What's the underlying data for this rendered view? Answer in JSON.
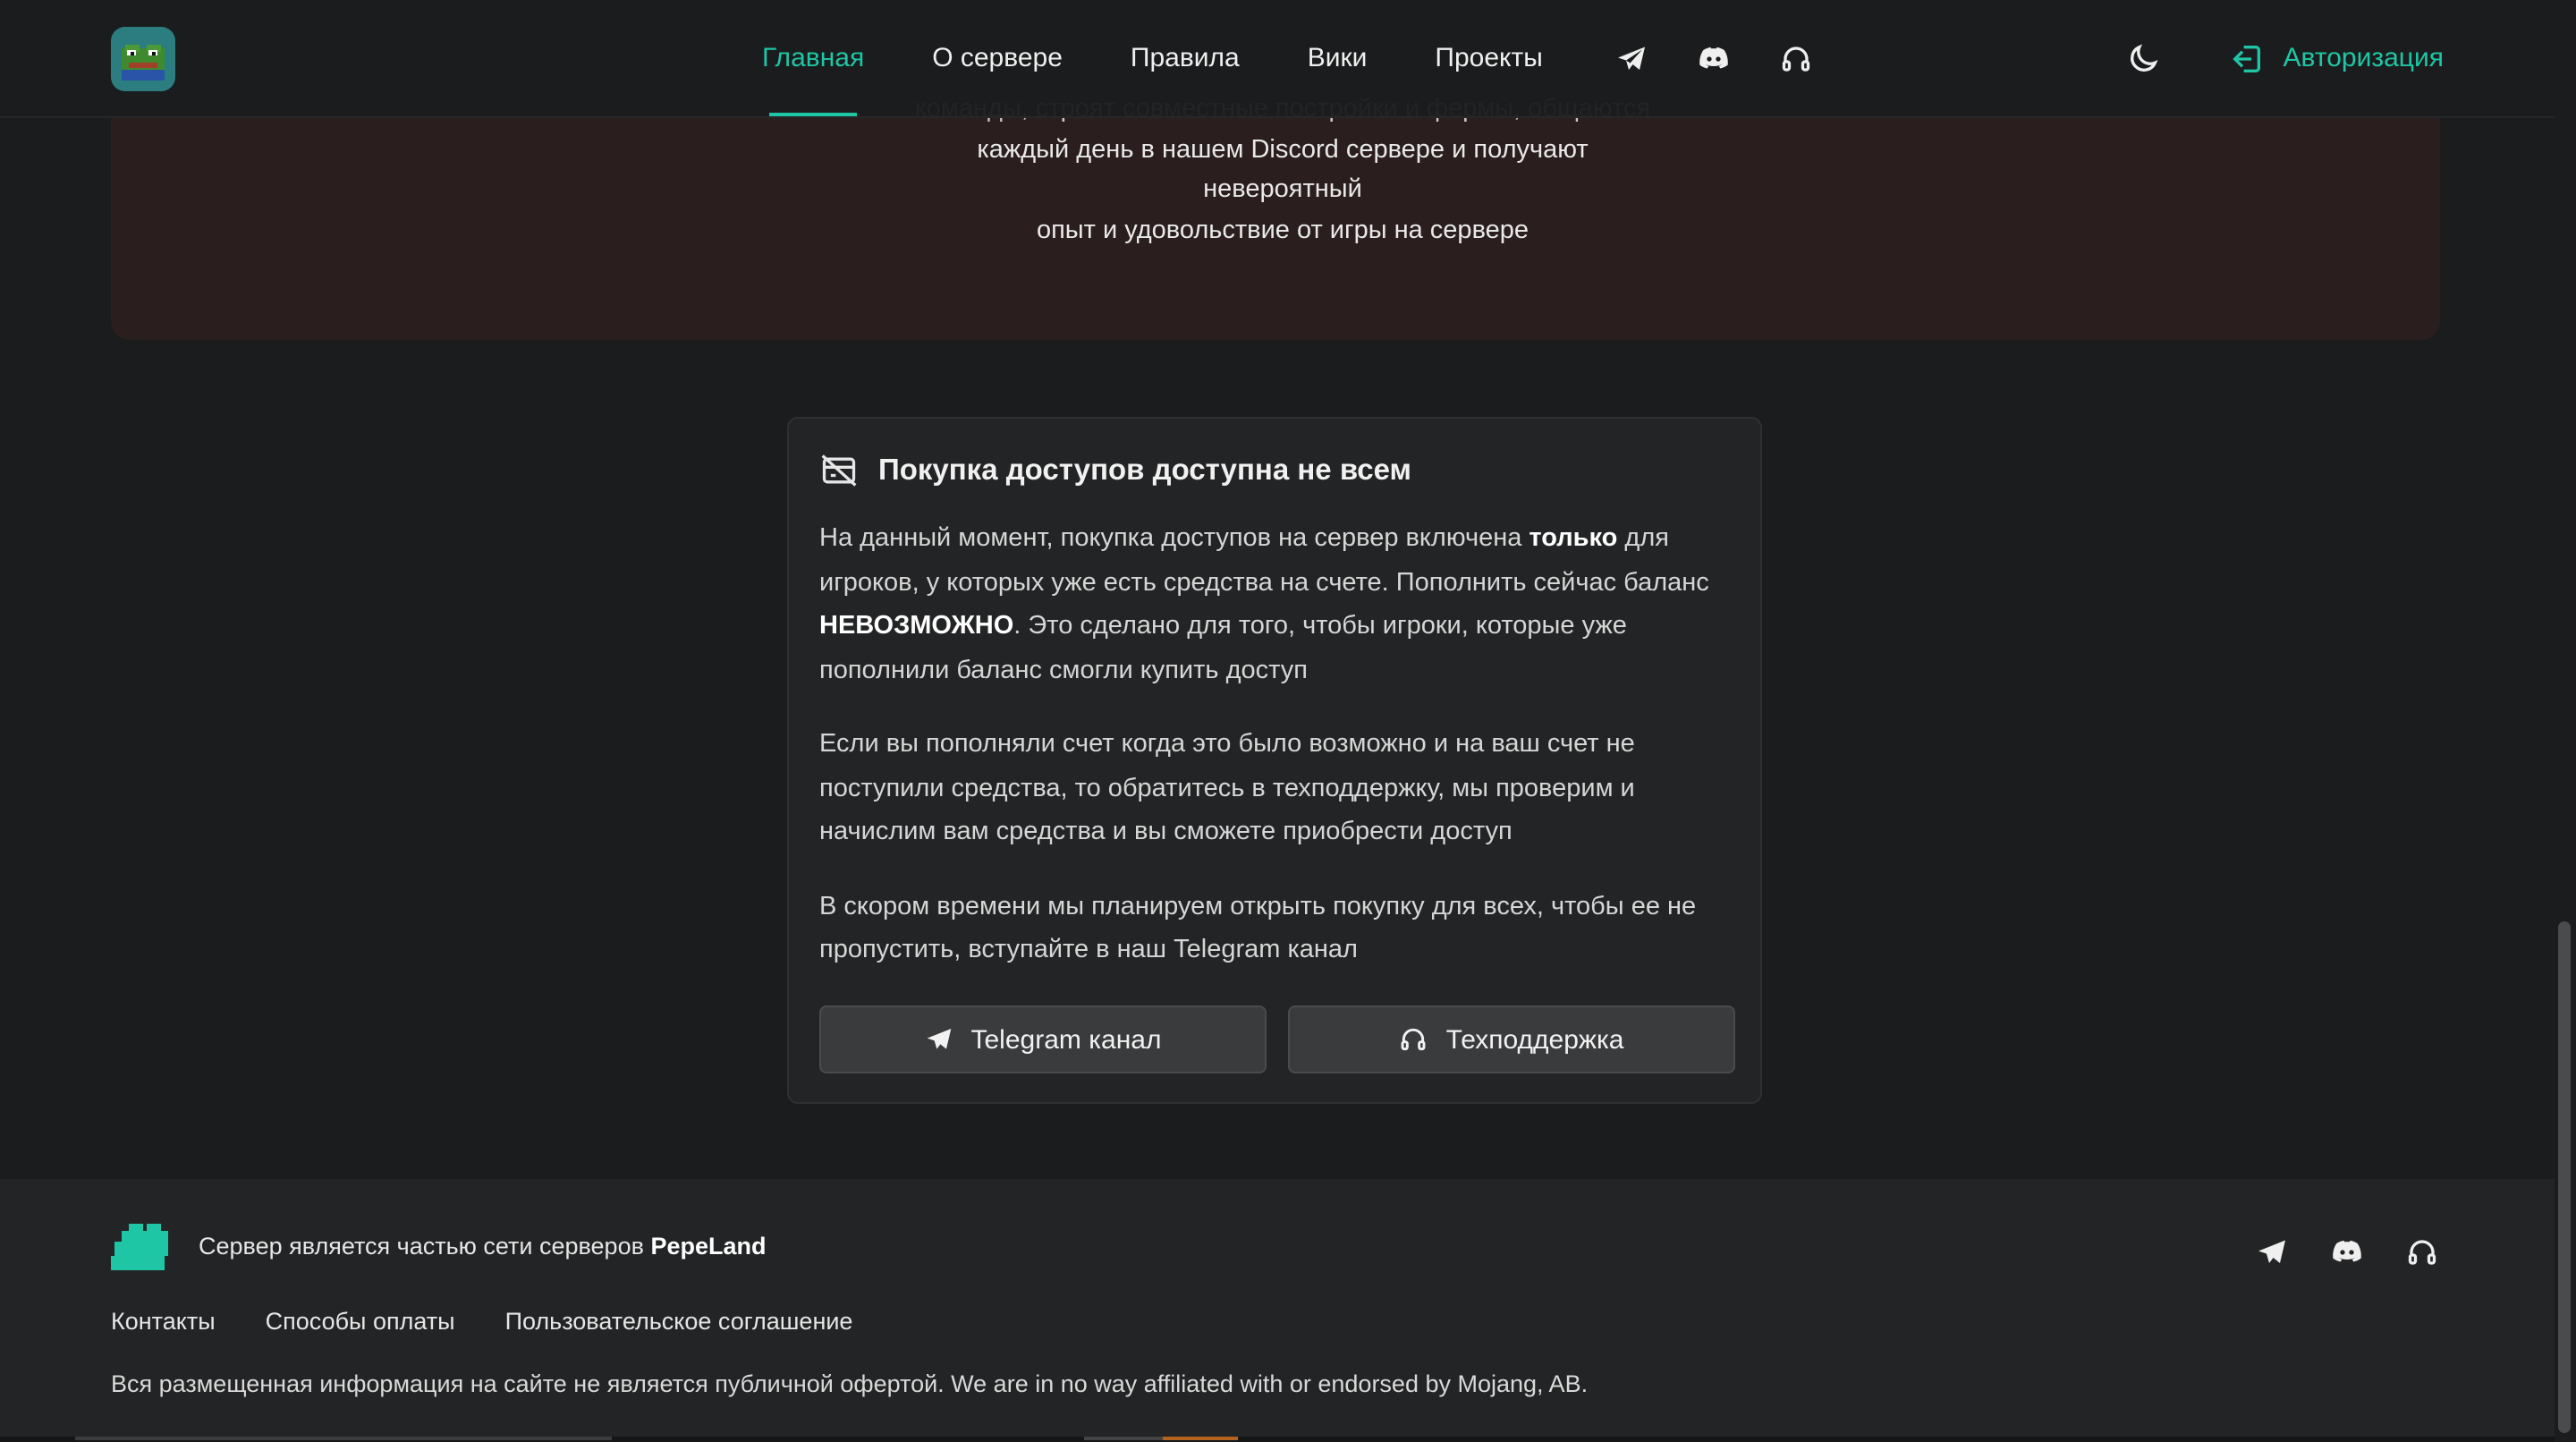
{
  "hero": {
    "line1": "команды, строят совместные постройки и фермы, общаются",
    "line2": "каждый день в нашем Discord сервере и получают невероятный",
    "line3": "опыт и удовольствие от игры на сервере"
  },
  "header": {
    "nav": [
      "Главная",
      "О сервере",
      "Правила",
      "Вики",
      "Проекты"
    ],
    "active_index": 0,
    "login_label": "Авторизация",
    "icons": [
      "telegram-icon",
      "discord-icon",
      "headset-icon",
      "moon-icon",
      "login-icon"
    ]
  },
  "notice": {
    "title": "Покупка доступов доступна не всем",
    "p1_a": "На данный момент, покупка доступов на сервер включена ",
    "p1_b": "только",
    "p1_c": " для игроков, у которых уже есть средства на счете. Пополнить сейчас баланс ",
    "p1_d": "НЕВОЗМОЖНО",
    "p1_e": ". Это сделано для того, чтобы игроки, которые уже пополнили баланс смогли купить доступ",
    "p2": "Если вы пополняли счет когда это было возможно и на ваш счет не поступили средства, то обратитесь в техподдержку, мы проверим и начислим вам средства и вы сможете приобрести доступ",
    "p3": "В скором времени мы планируем открыть покупку для всех, чтобы ее не пропустить, вступайте в наш Telegram канал",
    "btn_telegram": "Telegram канал",
    "btn_support": "Техподдержка"
  },
  "footer": {
    "network_text": "Сервер является частью сети серверов ",
    "network_name": "PepeLand",
    "links": [
      "Контакты",
      "Способы оплаты",
      "Пользовательское соглашение"
    ],
    "disclaimer": "Вся размещенная информация на сайте не является публичной офертой. We are in no way affiliated with or endorsed by Mojang, AB."
  },
  "colors": {
    "accent": "#1fc6a5",
    "background": "#1b1c1d",
    "card": "#232425"
  }
}
